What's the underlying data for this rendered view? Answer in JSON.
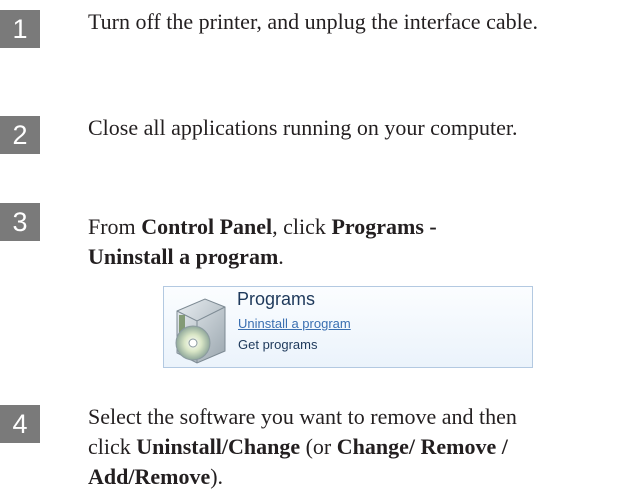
{
  "steps": [
    {
      "number": "1",
      "text": "Turn off the printer, and unplug the interface cable."
    },
    {
      "number": "2",
      "text": "Close all applications running on your computer."
    },
    {
      "number": "3",
      "text_a": "From ",
      "bold_a": "Control Panel",
      "text_b": ", click ",
      "bold_b": "Programs -",
      "bold_c": "Uninstall a program",
      "text_c": "."
    },
    {
      "number": "4",
      "text_a": "Select the software you want to remove and then click ",
      "bold_a": "Uninstall/Change",
      "text_b": " (or ",
      "bold_b": "Change/ Remove / Add/Remove",
      "text_c": ")."
    }
  ],
  "control_panel": {
    "title": "Programs",
    "uninstall_link": "Uninstall a program",
    "get_programs_link": "Get programs",
    "icon": "programs-icon"
  }
}
